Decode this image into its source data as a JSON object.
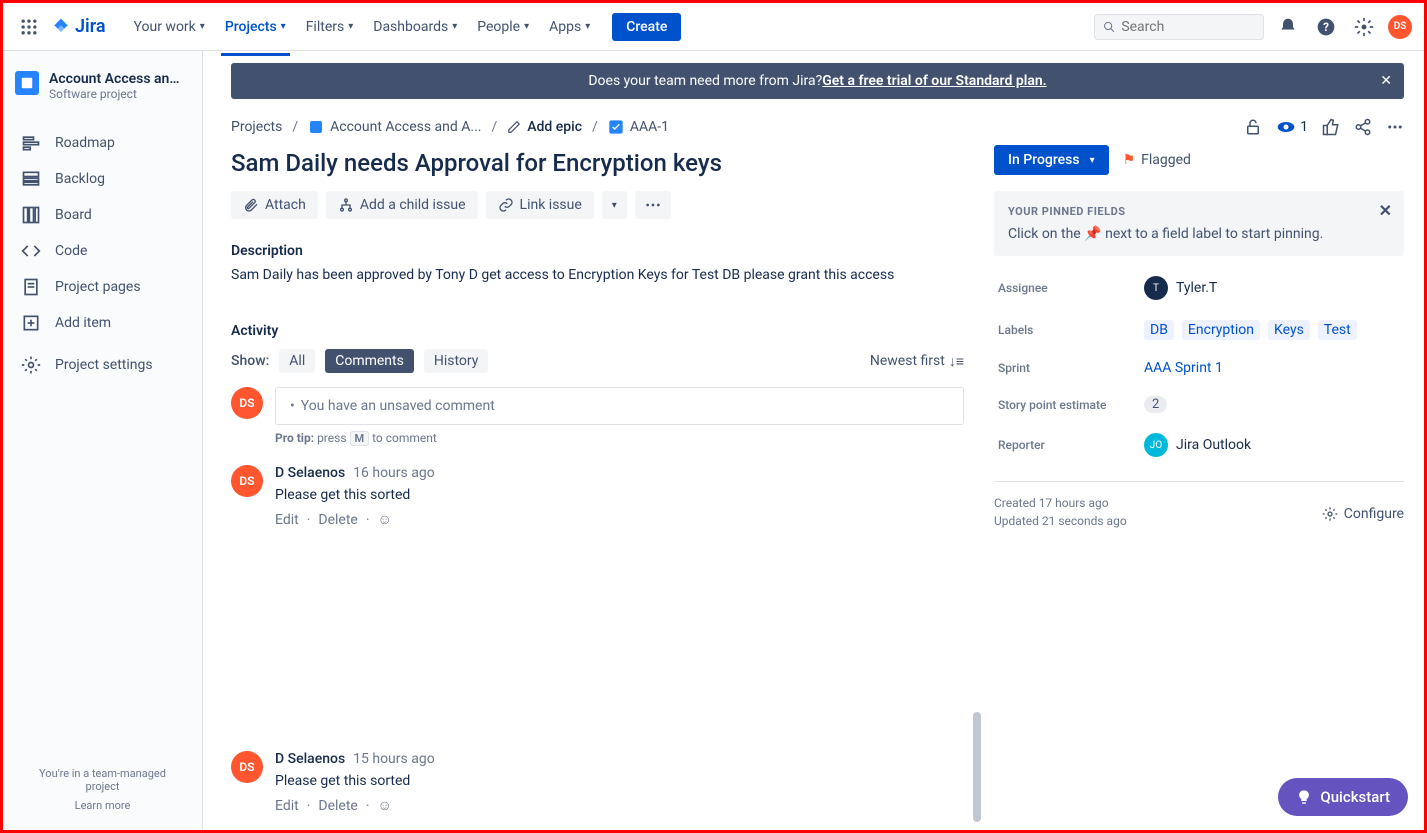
{
  "header": {
    "logo": "Jira",
    "nav": [
      "Your work",
      "Projects",
      "Filters",
      "Dashboards",
      "People",
      "Apps"
    ],
    "create": "Create",
    "search_placeholder": "Search"
  },
  "sidebar": {
    "project_name": "Account Access and Ap...",
    "project_type": "Software project",
    "items": [
      {
        "label": "Roadmap"
      },
      {
        "label": "Backlog"
      },
      {
        "label": "Board"
      },
      {
        "label": "Code"
      },
      {
        "label": "Project pages"
      },
      {
        "label": "Add item"
      },
      {
        "label": "Project settings"
      }
    ],
    "footer1": "You're in a team-managed project",
    "footer2": "Learn more"
  },
  "banner": {
    "text": "Does your team need more from Jira?  ",
    "link": "Get a free trial of our Standard plan."
  },
  "breadcrumb": {
    "projects": "Projects",
    "project": "Account Access and A...",
    "add_epic": "Add epic",
    "issue": "AAA-1",
    "watchers": "1"
  },
  "issue": {
    "title": "Sam Daily needs Approval for Encryption keys",
    "actions": {
      "attach": "Attach",
      "add_child": "Add a child issue",
      "link": "Link issue"
    },
    "description_label": "Description",
    "description": "Sam Daily has been approved by Tony D  get access to Encryption Keys for Test DB please grant this access"
  },
  "activity": {
    "label": "Activity",
    "show": "Show:",
    "tabs": [
      "All",
      "Comments",
      "History"
    ],
    "newest": "Newest first",
    "unsaved": "You have an unsaved comment",
    "protip_pre": "Pro tip: ",
    "protip_press": "press",
    "protip_key": "M",
    "protip_post": "to comment"
  },
  "comments": [
    {
      "author": "D Selaenos",
      "time": "16 hours ago",
      "text": "Please get this sorted",
      "avatar": "DS"
    },
    {
      "author": "D Selaenos",
      "time": "15 hours ago",
      "text": "Please get this sorted",
      "avatar": "DS"
    }
  ],
  "comment_actions": {
    "edit": "Edit",
    "delete": "Delete"
  },
  "current_user_avatar": "DS",
  "right": {
    "status": "In Progress",
    "flagged": "Flagged",
    "pinned_title": "YOUR PINNED FIELDS",
    "pinned_hint_pre": "Click on the ",
    "pinned_hint_post": " next to a field label to start pinning.",
    "fields": {
      "assignee_label": "Assignee",
      "assignee_value": "Tyler.T",
      "assignee_initial": "T",
      "labels_label": "Labels",
      "labels": [
        "DB",
        "Encryption",
        "Keys",
        "Test"
      ],
      "sprint_label": "Sprint",
      "sprint_value": "AAA Sprint 1",
      "sp_label": "Story point estimate",
      "sp_value": "2",
      "reporter_label": "Reporter",
      "reporter_value": "Jira Outlook",
      "reporter_initial": "JO"
    },
    "created": "Created 17 hours ago",
    "updated": "Updated 21 seconds ago",
    "configure": "Configure"
  },
  "quickstart": "Quickstart"
}
